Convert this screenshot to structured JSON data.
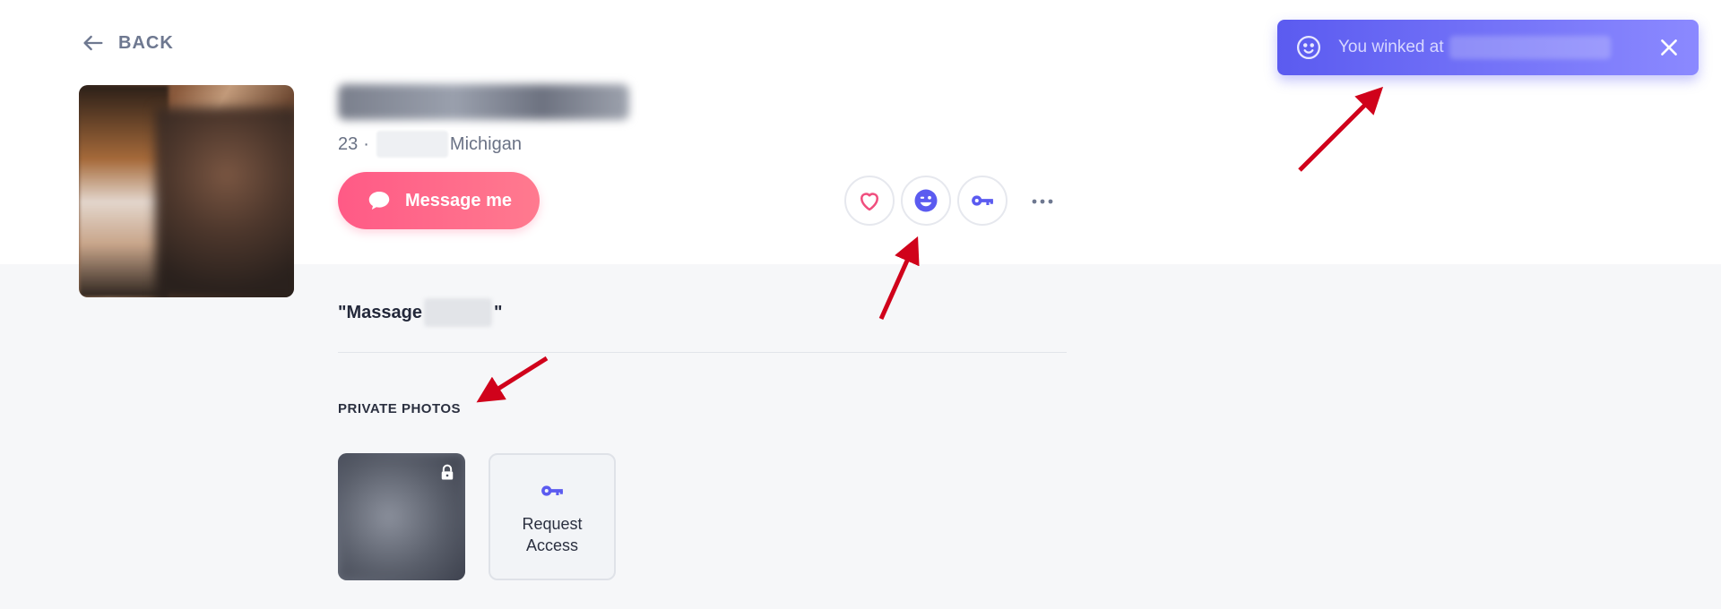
{
  "nav": {
    "back_label": "BACK"
  },
  "profile": {
    "age": "23",
    "separator": "·",
    "location": "Michigan",
    "headline_open": "\"Massage",
    "headline_close": "\""
  },
  "actions": {
    "message_label": "Message me",
    "request_access_label": "Request Access"
  },
  "private_photos": {
    "title": "PRIVATE PHOTOS"
  },
  "toast": {
    "text": "You winked at"
  },
  "colors": {
    "accent": "#5b5bf0",
    "pink": "#ff5a86",
    "annotation": "#d0021b"
  },
  "icons": [
    "back-arrow-icon",
    "chat-bubble-icon",
    "heart-icon",
    "wink-icon",
    "key-icon",
    "more-icon",
    "lock-icon",
    "smile-icon",
    "close-icon"
  ]
}
